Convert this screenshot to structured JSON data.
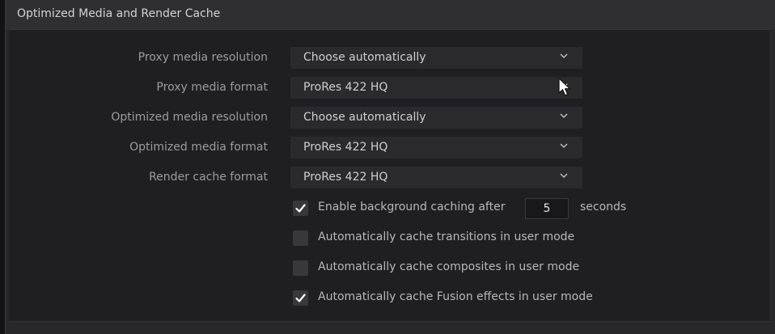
{
  "panel": {
    "title": "Optimized Media and Render Cache"
  },
  "settings": [
    {
      "label": "Proxy media resolution",
      "value": "Choose automatically"
    },
    {
      "label": "Proxy media format",
      "value": "ProRes 422 HQ"
    },
    {
      "label": "Optimized media resolution",
      "value": "Choose automatically"
    },
    {
      "label": "Optimized media format",
      "value": "ProRes 422 HQ"
    },
    {
      "label": "Render cache format",
      "value": "ProRes 422 HQ"
    }
  ],
  "background_caching": {
    "label": "Enable background caching after",
    "checked": true,
    "value": "5",
    "suffix": "seconds"
  },
  "options": [
    {
      "label": "Automatically cache transitions in user mode",
      "checked": false
    },
    {
      "label": "Automatically cache composites in user mode",
      "checked": false
    },
    {
      "label": "Automatically cache Fusion effects in user mode",
      "checked": true
    }
  ],
  "icons": {
    "dropdown": "chevron-down-icon",
    "checkbox_checked": "checkmark-icon",
    "pointer": "mouse-pointer-icon"
  },
  "colors": {
    "panel": "#28282b",
    "body": "#1f1f21",
    "dropdown": "#2a2a2d",
    "checkbox": "#38383b",
    "check": "#ffffff"
  }
}
